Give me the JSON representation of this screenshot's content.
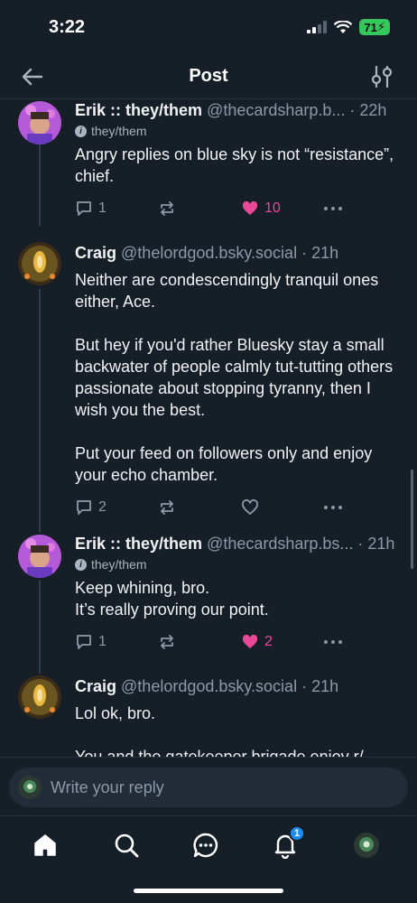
{
  "status": {
    "time": "3:22",
    "battery": "71"
  },
  "header": {
    "title": "Post"
  },
  "posts": [
    {
      "name": "Erik :: they/them",
      "handle": "@thecardsharp.b...",
      "time": " · 22h",
      "pronouns": "they/them",
      "text": "Angry replies on blue sky is not “resistance”, chief.",
      "replies": "1",
      "likes": "10"
    },
    {
      "name": "Craig",
      "handle": "@thelordgod.bsky.social",
      "time": " · 21h",
      "text": "Neither are condescendingly tranquil ones either, Ace.\n\nBut hey if you'd rather Bluesky stay a small backwater of people calmly tut-tutting others passionate about stopping tyranny, then I wish you the best.\n\nPut your feed on followers only and enjoy your echo chamber.",
      "replies": "2",
      "likes": ""
    },
    {
      "name": "Erik :: they/them",
      "handle": "@thecardsharp.bs...",
      "time": " · 21h",
      "pronouns": "they/them",
      "text": "Keep whining, bro.\nIt’s really proving our point.",
      "replies": "1",
      "likes": "2"
    },
    {
      "name": "Craig",
      "handle": "@thelordgod.bsky.social",
      "time": " · 21h",
      "text": "Lol ok, bro.\n\nYou and the gatekeeper brigade enjoy r/"
    }
  ],
  "reply": {
    "placeholder": "Write your reply"
  },
  "nav": {
    "notifications_badge": "1"
  },
  "colors": {
    "background": "#161e27",
    "like": "#ec4899",
    "muted": "#8c9aa8",
    "badge": "#1d8cf0"
  },
  "icons": [
    "back-arrow-icon",
    "filter-icon",
    "reply-icon",
    "repost-icon",
    "heart-icon",
    "more-icon",
    "home-icon",
    "search-icon",
    "chat-icon",
    "bell-icon"
  ]
}
